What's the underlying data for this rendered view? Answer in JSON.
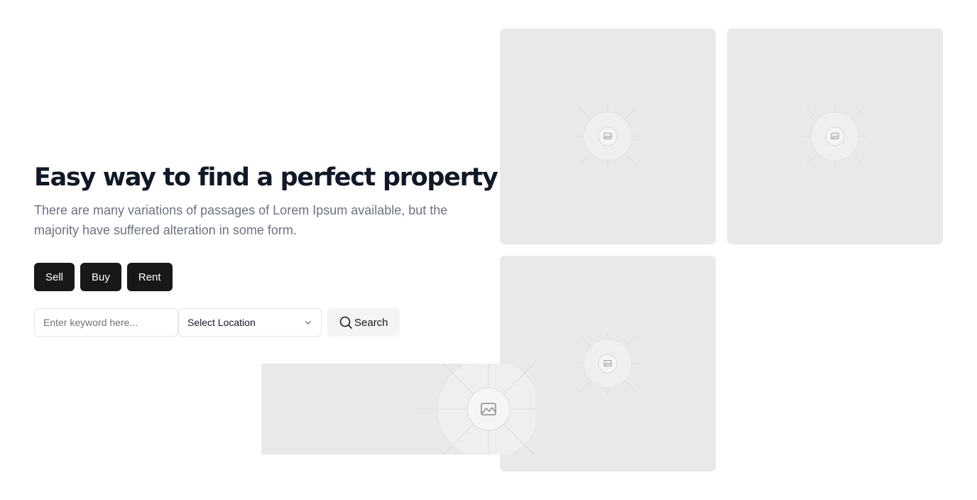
{
  "hero": {
    "title": "Easy way to find a perfect property",
    "description": "There are many variations of passages of Lorem Ipsum available, but the majority have suffered alteration in some form."
  },
  "tabs": [
    {
      "label": "Sell"
    },
    {
      "label": "Buy"
    },
    {
      "label": "Rent"
    }
  ],
  "search": {
    "keyword_placeholder": "Enter keyword here...",
    "keyword_value": "",
    "location_value": "Select Location",
    "button_label": "Search",
    "button_icon": "search-icon",
    "select_icon": "chevron-down-icon"
  },
  "gallery": {
    "placeholder_icon": "image-icon",
    "placeholder_color": "#e9e9e9"
  }
}
